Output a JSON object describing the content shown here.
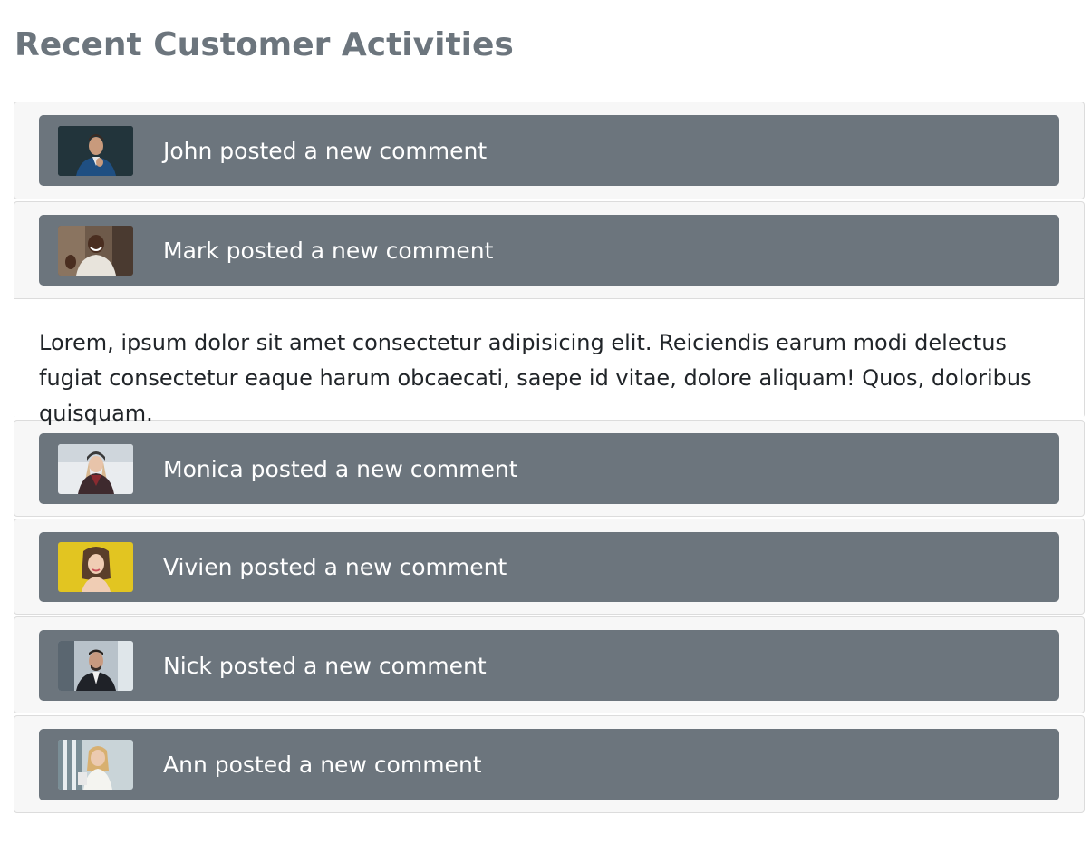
{
  "page": {
    "title": "Recent Customer Activities"
  },
  "colors": {
    "button_bg": "#6c757d",
    "item_bg": "#f7f7f7",
    "title": "#6c757d",
    "body_text": "#212529"
  },
  "activities": [
    {
      "name": "John",
      "label": "John posted a new comment",
      "expanded": false,
      "avatar": "john-photo"
    },
    {
      "name": "Mark",
      "label": "Mark posted a new comment",
      "expanded": true,
      "avatar": "mark-photo",
      "body": "Lorem, ipsum dolor sit amet consectetur adipisicing elit. Reiciendis earum modi delectus fugiat consectetur eaque harum obcaecati, saepe id vitae, dolore aliquam! Quos, doloribus quisquam."
    },
    {
      "name": "Monica",
      "label": "Monica posted a new comment",
      "expanded": false,
      "avatar": "monica-photo"
    },
    {
      "name": "Vivien",
      "label": "Vivien posted a new comment",
      "expanded": false,
      "avatar": "vivien-photo"
    },
    {
      "name": "Nick",
      "label": "Nick posted a new comment",
      "expanded": false,
      "avatar": "nick-photo"
    },
    {
      "name": "Ann",
      "label": "Ann posted a new comment",
      "expanded": false,
      "avatar": "ann-photo"
    }
  ]
}
